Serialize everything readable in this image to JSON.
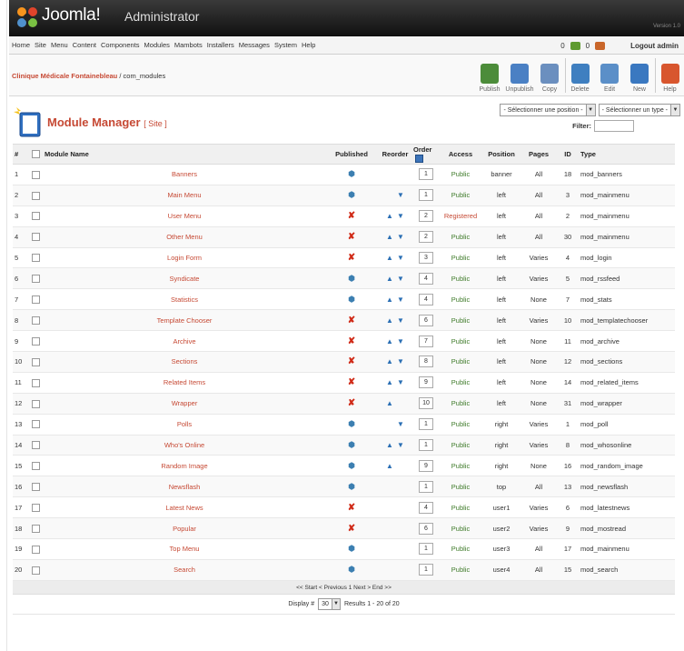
{
  "header": {
    "brand": "Joomla!",
    "subtitle": "Administrator",
    "version": "Version 1.0"
  },
  "menubar": {
    "items": [
      "Home",
      "Site",
      "Menu",
      "Content",
      "Components",
      "Modules",
      "Mambots",
      "Installers",
      "Messages",
      "System",
      "Help"
    ],
    "messages_count": "0",
    "users_count": "0",
    "logout": "Logout admin"
  },
  "breadcrumb": {
    "site": "Clinique Médicale Fontainebleau",
    "path": " / com_modules"
  },
  "toolbar": {
    "buttons": [
      {
        "label": "Publish",
        "icon": "publish-icon",
        "color": "#4c8c3a"
      },
      {
        "label": "Unpublish",
        "icon": "unpublish-icon",
        "color": "#4a80c4"
      },
      {
        "label": "Copy",
        "icon": "copy-icon",
        "color": "#6b8fbf"
      },
      {
        "label": "Delete",
        "icon": "delete-icon",
        "color": "#3f7fc0"
      },
      {
        "label": "Edit",
        "icon": "edit-icon",
        "color": "#5b8fc8"
      },
      {
        "label": "New",
        "icon": "new-icon",
        "color": "#3a78c0"
      },
      {
        "label": "Help",
        "icon": "help-icon",
        "color": "#d8562e"
      }
    ]
  },
  "page": {
    "title": "Module Manager",
    "subtitle": "[ Site ]",
    "position_select": "- Sélectionner une position -",
    "type_select": "- Sélectionner un type -",
    "filter_label": "Filter:",
    "filter_value": ""
  },
  "table": {
    "headers": {
      "num": "#",
      "name": "Module Name",
      "published": "Published",
      "reorder": "Reorder",
      "order": "Order",
      "access": "Access",
      "position": "Position",
      "pages": "Pages",
      "id": "ID",
      "type": "Type"
    },
    "rows": [
      {
        "num": "1",
        "name": "Banners",
        "published": true,
        "up": false,
        "down": false,
        "order": "1",
        "access": "Public",
        "position": "banner",
        "pages": "All",
        "id": "18",
        "type": "mod_banners"
      },
      {
        "num": "2",
        "name": "Main Menu",
        "published": true,
        "up": false,
        "down": true,
        "order": "1",
        "access": "Public",
        "position": "left",
        "pages": "All",
        "id": "3",
        "type": "mod_mainmenu"
      },
      {
        "num": "3",
        "name": "User Menu",
        "published": false,
        "up": true,
        "down": true,
        "order": "2",
        "access": "Registered",
        "position": "left",
        "pages": "All",
        "id": "2",
        "type": "mod_mainmenu"
      },
      {
        "num": "4",
        "name": "Other Menu",
        "published": false,
        "up": true,
        "down": true,
        "order": "2",
        "access": "Public",
        "position": "left",
        "pages": "All",
        "id": "30",
        "type": "mod_mainmenu"
      },
      {
        "num": "5",
        "name": "Login Form",
        "published": false,
        "up": true,
        "down": true,
        "order": "3",
        "access": "Public",
        "position": "left",
        "pages": "Varies",
        "id": "4",
        "type": "mod_login"
      },
      {
        "num": "6",
        "name": "Syndicate",
        "published": true,
        "up": true,
        "down": true,
        "order": "4",
        "access": "Public",
        "position": "left",
        "pages": "Varies",
        "id": "5",
        "type": "mod_rssfeed"
      },
      {
        "num": "7",
        "name": "Statistics",
        "published": true,
        "up": true,
        "down": true,
        "order": "4",
        "access": "Public",
        "position": "left",
        "pages": "None",
        "id": "7",
        "type": "mod_stats"
      },
      {
        "num": "8",
        "name": "Template Chooser",
        "published": false,
        "up": true,
        "down": true,
        "order": "6",
        "access": "Public",
        "position": "left",
        "pages": "Varies",
        "id": "10",
        "type": "mod_templatechooser"
      },
      {
        "num": "9",
        "name": "Archive",
        "published": false,
        "up": true,
        "down": true,
        "order": "7",
        "access": "Public",
        "position": "left",
        "pages": "None",
        "id": "11",
        "type": "mod_archive"
      },
      {
        "num": "10",
        "name": "Sections",
        "published": false,
        "up": true,
        "down": true,
        "order": "8",
        "access": "Public",
        "position": "left",
        "pages": "None",
        "id": "12",
        "type": "mod_sections"
      },
      {
        "num": "11",
        "name": "Related Items",
        "published": false,
        "up": true,
        "down": true,
        "order": "9",
        "access": "Public",
        "position": "left",
        "pages": "None",
        "id": "14",
        "type": "mod_related_items"
      },
      {
        "num": "12",
        "name": "Wrapper",
        "published": false,
        "up": true,
        "down": false,
        "order": "10",
        "access": "Public",
        "position": "left",
        "pages": "None",
        "id": "31",
        "type": "mod_wrapper"
      },
      {
        "num": "13",
        "name": "Polls",
        "published": true,
        "up": false,
        "down": true,
        "order": "1",
        "access": "Public",
        "position": "right",
        "pages": "Varies",
        "id": "1",
        "type": "mod_poll"
      },
      {
        "num": "14",
        "name": "Who's Online",
        "published": true,
        "up": true,
        "down": true,
        "order": "1",
        "access": "Public",
        "position": "right",
        "pages": "Varies",
        "id": "8",
        "type": "mod_whosonline"
      },
      {
        "num": "15",
        "name": "Random Image",
        "published": true,
        "up": true,
        "down": false,
        "order": "9",
        "access": "Public",
        "position": "right",
        "pages": "None",
        "id": "16",
        "type": "mod_random_image"
      },
      {
        "num": "16",
        "name": "Newsflash",
        "published": true,
        "up": false,
        "down": false,
        "order": "1",
        "access": "Public",
        "position": "top",
        "pages": "All",
        "id": "13",
        "type": "mod_newsflash"
      },
      {
        "num": "17",
        "name": "Latest News",
        "published": false,
        "up": false,
        "down": false,
        "order": "4",
        "access": "Public",
        "position": "user1",
        "pages": "Varies",
        "id": "6",
        "type": "mod_latestnews"
      },
      {
        "num": "18",
        "name": "Popular",
        "published": false,
        "up": false,
        "down": false,
        "order": "6",
        "access": "Public",
        "position": "user2",
        "pages": "Varies",
        "id": "9",
        "type": "mod_mostread"
      },
      {
        "num": "19",
        "name": "Top Menu",
        "published": true,
        "up": false,
        "down": false,
        "order": "1",
        "access": "Public",
        "position": "user3",
        "pages": "All",
        "id": "17",
        "type": "mod_mainmenu"
      },
      {
        "num": "20",
        "name": "Search",
        "published": true,
        "up": false,
        "down": false,
        "order": "1",
        "access": "Public",
        "position": "user4",
        "pages": "All",
        "id": "15",
        "type": "mod_search"
      }
    ]
  },
  "footer": {
    "pager": "<< Start < Previous 1 Next > End >>",
    "display_label": "Display #",
    "display_value": "30",
    "results": "Results 1 - 20 of 20"
  },
  "colors": {
    "accent": "#c64934",
    "public": "#3d7a28",
    "published": "#3c7fb1",
    "unpublished": "#d02a17"
  }
}
